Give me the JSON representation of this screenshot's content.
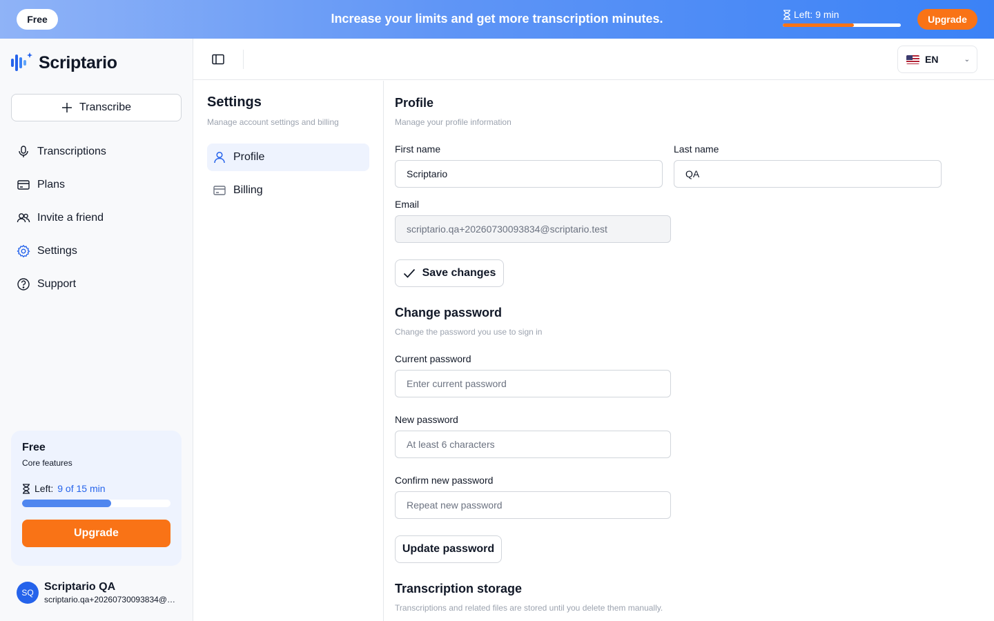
{
  "banner": {
    "plan_pill": "Free",
    "message": "Increase your limits and get more transcription minutes.",
    "left_label": "Left:",
    "left_value": "9 min",
    "left_fraction": 0.6,
    "upgrade_label": "Upgrade"
  },
  "sidebar": {
    "logo_text": "Scriptario",
    "transcribe_label": "Transcribe",
    "items": [
      {
        "label": "Transcriptions",
        "icon": "microphone-icon"
      },
      {
        "label": "Plans",
        "icon": "card-icon"
      },
      {
        "label": "Invite a friend",
        "icon": "users-icon"
      },
      {
        "label": "Settings",
        "icon": "gear-icon"
      },
      {
        "label": "Support",
        "icon": "help-icon"
      }
    ],
    "plan": {
      "name": "Free",
      "description": "Core features",
      "left_label": "Left:",
      "left_value": "9 of 15 min",
      "used_fraction": 0.6,
      "upgrade_label": "Upgrade"
    },
    "user": {
      "initials": "SQ",
      "name": "Scriptario QA",
      "email": "scriptario.qa+20260730093834@scriptario.test"
    }
  },
  "header": {
    "language": "EN"
  },
  "settings_menu": {
    "title": "Settings",
    "description": "Manage account settings and billing",
    "items": [
      {
        "label": "Profile",
        "active": true
      },
      {
        "label": "Billing",
        "active": false
      }
    ]
  },
  "profile": {
    "title": "Profile",
    "description": "Manage your profile information",
    "first_name_label": "First name",
    "first_name_value": "Scriptario",
    "last_name_label": "Last name",
    "last_name_value": "QA",
    "email_label": "Email",
    "email_value": "scriptario.qa+20260730093834@scriptario.test",
    "save_label": "Save changes"
  },
  "password": {
    "title": "Change password",
    "description": "Change the password you use to sign in",
    "current_label": "Current password",
    "current_placeholder": "Enter current password",
    "new_label": "New password",
    "new_placeholder": "At least 6 characters",
    "confirm_label": "Confirm new password",
    "confirm_placeholder": "Repeat new password",
    "update_label": "Update password"
  },
  "storage": {
    "title": "Transcription storage",
    "description": "Transcriptions and related files are stored until you delete them manually."
  },
  "colors": {
    "accent": "#2563eb",
    "upgrade": "#f97316"
  }
}
